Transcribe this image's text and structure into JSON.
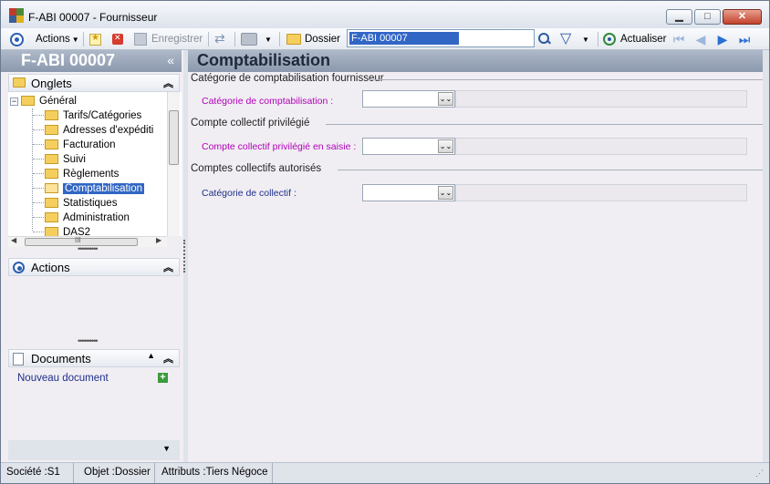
{
  "window": {
    "title": "F-ABI 00007 -  Fournisseur",
    "min_glyph": "▁",
    "max_glyph": "□",
    "close_glyph": "✕"
  },
  "toolbar": {
    "actions_label": "Actions",
    "save_label": "Enregistrer",
    "dossier_label": "Dossier",
    "search_value": "F-ABI 00007",
    "refresh_label": "Actualiser"
  },
  "left": {
    "record_code": "F-ABI 00007",
    "record_chevron": "«",
    "onglets_title": "Onglets",
    "tree": {
      "root": "Général",
      "items": [
        "Tarifs/Catégories",
        "Adresses d'expéditi",
        "Facturation",
        "Suivi",
        "Règlements",
        "Comptabilisation",
        "Statistiques",
        "Administration",
        "DAS2"
      ],
      "selected": "Comptabilisation"
    },
    "hscroll_grip": "III",
    "actions_title": "Actions",
    "documents_title": "Documents",
    "new_document": "Nouveau document",
    "collapse_glyph": "⌃",
    "grip": "••••••••••"
  },
  "main": {
    "title": "Comptabilisation",
    "sections": [
      {
        "title": "Catégorie de comptabilisation fournisseur",
        "label": "Catégorie de comptabilisation :",
        "color": "#b000b8"
      },
      {
        "title": "Compte collectif privilégié",
        "label": "Compte collectif privilégié en saisie :",
        "color": "#b000b8"
      },
      {
        "title": "Comptes collectifs autorisés",
        "label": "Catégorie de collectif :",
        "color": "#1e2f8a"
      }
    ],
    "combo_glyph": "⌄"
  },
  "status": {
    "societe": "Société :S1",
    "objet": "Objet :Dossier",
    "attributs": "Attributs :Tiers Négoce"
  }
}
